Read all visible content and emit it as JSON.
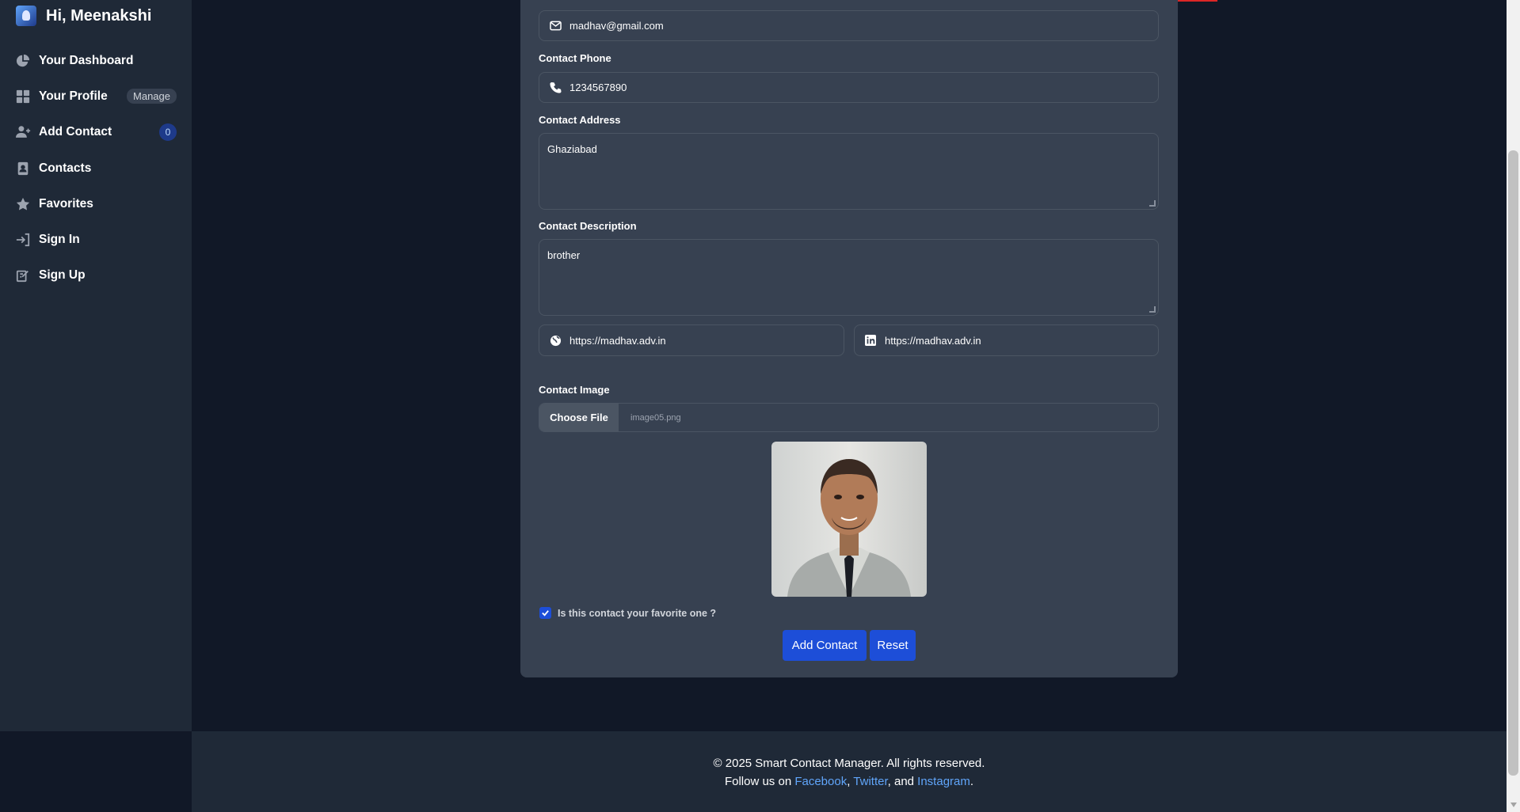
{
  "sidebar": {
    "greeting": "Hi, Meenakshi",
    "items": [
      {
        "label": "Your Dashboard",
        "icon": "chart-pie-icon"
      },
      {
        "label": "Your Profile",
        "icon": "grid-icon",
        "badge": "Manage"
      },
      {
        "label": "Add Contact",
        "icon": "user-plus-icon",
        "badge": "0"
      },
      {
        "label": "Contacts",
        "icon": "address-book-icon"
      },
      {
        "label": "Favorites",
        "icon": "star-icon"
      },
      {
        "label": "Sign In",
        "icon": "sign-in-icon"
      },
      {
        "label": "Sign Up",
        "icon": "sign-up-icon"
      }
    ]
  },
  "form": {
    "email_value": "madhav@gmail.com",
    "phone_label": "Contact Phone",
    "phone_value": "1234567890",
    "address_label": "Contact Address",
    "address_value": "Ghaziabad",
    "description_label": "Contact Description",
    "description_value": "brother",
    "website_value": "https://madhav.adv.in",
    "linkedin_value": "https://madhav.adv.in",
    "image_label": "Contact Image",
    "choose_file_label": "Choose File",
    "file_name": "image05.png",
    "favorite_label": "Is this contact your favorite one ?",
    "favorite_checked": true,
    "add_button": "Add Contact",
    "reset_button": "Reset"
  },
  "footer": {
    "copyright": "© 2025 Smart Contact Manager. All rights reserved.",
    "follow_prefix": "Follow us on ",
    "facebook": "Facebook",
    "twitter": "Twitter",
    "and": ", and ",
    "instagram": "Instagram",
    "comma": ", ",
    "period": "."
  },
  "colors": {
    "accent": "#1d4ed8",
    "background": "#111827",
    "sidebar": "#1f2937",
    "card": "#374151",
    "link": "#60a5fa"
  }
}
